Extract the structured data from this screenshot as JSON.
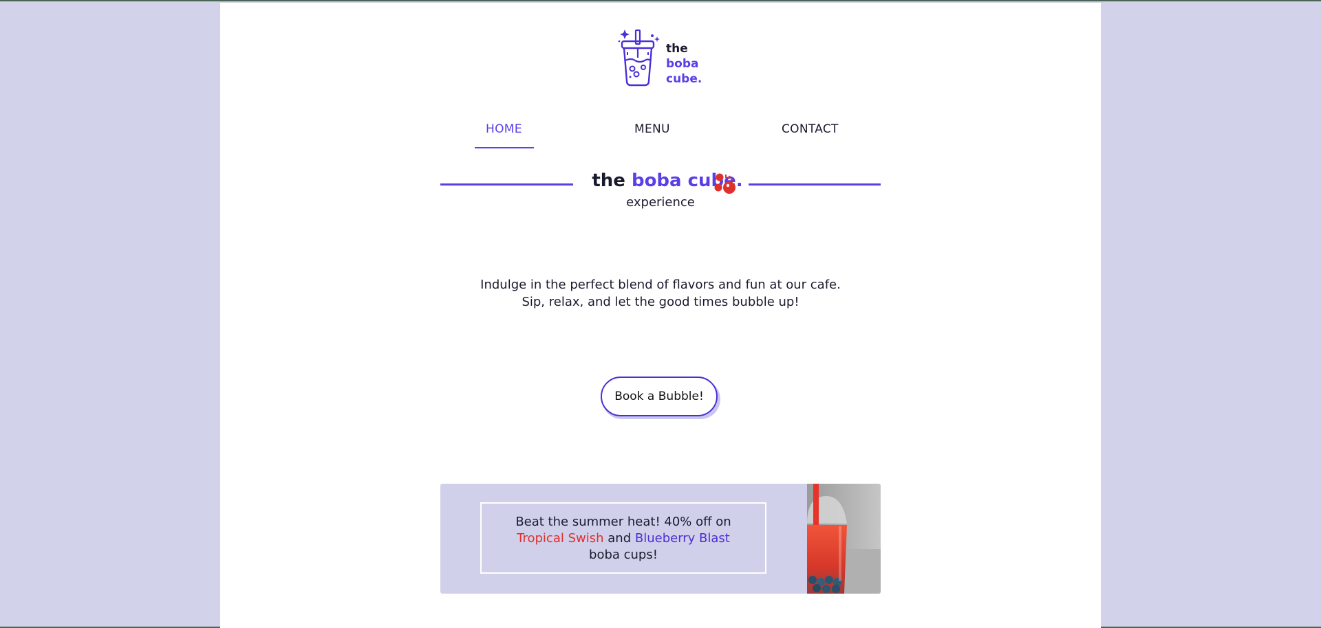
{
  "logo": {
    "word1": "the",
    "word2": "boba",
    "word3": "cube."
  },
  "nav": {
    "items": [
      {
        "label": "HOME",
        "active": true
      },
      {
        "label": "MENU",
        "active": false
      },
      {
        "label": "CONTACT",
        "active": false
      }
    ]
  },
  "hero": {
    "heading_the": "the",
    "heading_brand": "boba cube.",
    "subheading": "experience",
    "intro_line1": "Indulge in the perfect blend of flavors and fun at our cafe.",
    "intro_line2": "Sip, relax, and let the good times bubble up!",
    "cta_label": "Book a Bubble!"
  },
  "promo": {
    "text_before": "Beat the summer heat! 40% off on",
    "flavor1": "Tropical Swish",
    "connector": "and",
    "flavor2": "Blueberry Blast",
    "text_after": "boba cups!"
  },
  "colors": {
    "page_background": "#d2d2ea",
    "accent": "#5a3ee6",
    "promo_red": "#e0302c",
    "promo_background": "#d0d0ea"
  },
  "icons": [
    "boba-cup-logo-icon",
    "bubbles-icon",
    "boba-drink-photo"
  ]
}
